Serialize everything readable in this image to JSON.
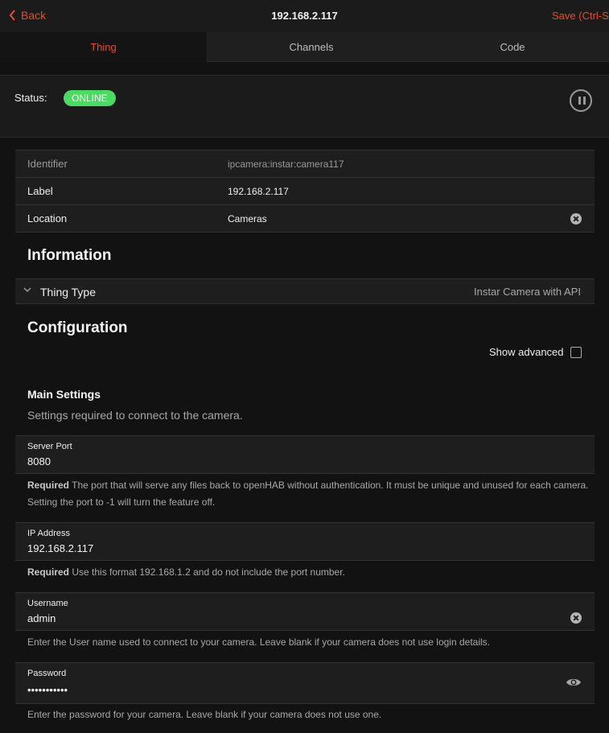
{
  "navbar": {
    "back_label": "Back",
    "title": "192.168.2.117",
    "save_label": "Save (Ctrl-S"
  },
  "tabs": [
    {
      "label": "Thing",
      "active": true
    },
    {
      "label": "Channels",
      "active": false
    },
    {
      "label": "Code",
      "active": false
    }
  ],
  "status": {
    "label": "Status:",
    "badge": "ONLINE",
    "badge_color": "#4cd964"
  },
  "properties": {
    "identifier": {
      "label": "Identifier",
      "value": "ipcamera:instar:camera117"
    },
    "label": {
      "label": "Label",
      "value": "192.168.2.117"
    },
    "location": {
      "label": "Location",
      "value": "Cameras"
    }
  },
  "information": {
    "title": "Information",
    "thing_type_label": "Thing Type",
    "thing_type_value": "Instar Camera with API"
  },
  "configuration": {
    "title": "Configuration",
    "show_advanced": "Show advanced",
    "main_settings_title": "Main Settings",
    "main_settings_desc": "Settings required to connect to the camera.",
    "fields": {
      "server_port": {
        "label": "Server Port",
        "value": "8080",
        "required": "Required",
        "help": " The port that will serve any files back to openHAB without authentication. It must be unique and unused for each camera. Setting the port to -1 will turn the feature off."
      },
      "ip_address": {
        "label": "IP Address",
        "value": "192.168.2.117",
        "required": "Required",
        "help": " Use this format 192.168.1.2 and do not include the port number."
      },
      "username": {
        "label": "Username",
        "value": "admin",
        "help": "Enter the User name used to connect to your camera. Leave blank if your camera does not use login details."
      },
      "password": {
        "label": "Password",
        "value": "•••••••••••",
        "help": "Enter the password for your camera. Leave blank if your camera does not use one."
      }
    }
  },
  "colors": {
    "accent": "#e74c2c",
    "background": "#121212"
  }
}
